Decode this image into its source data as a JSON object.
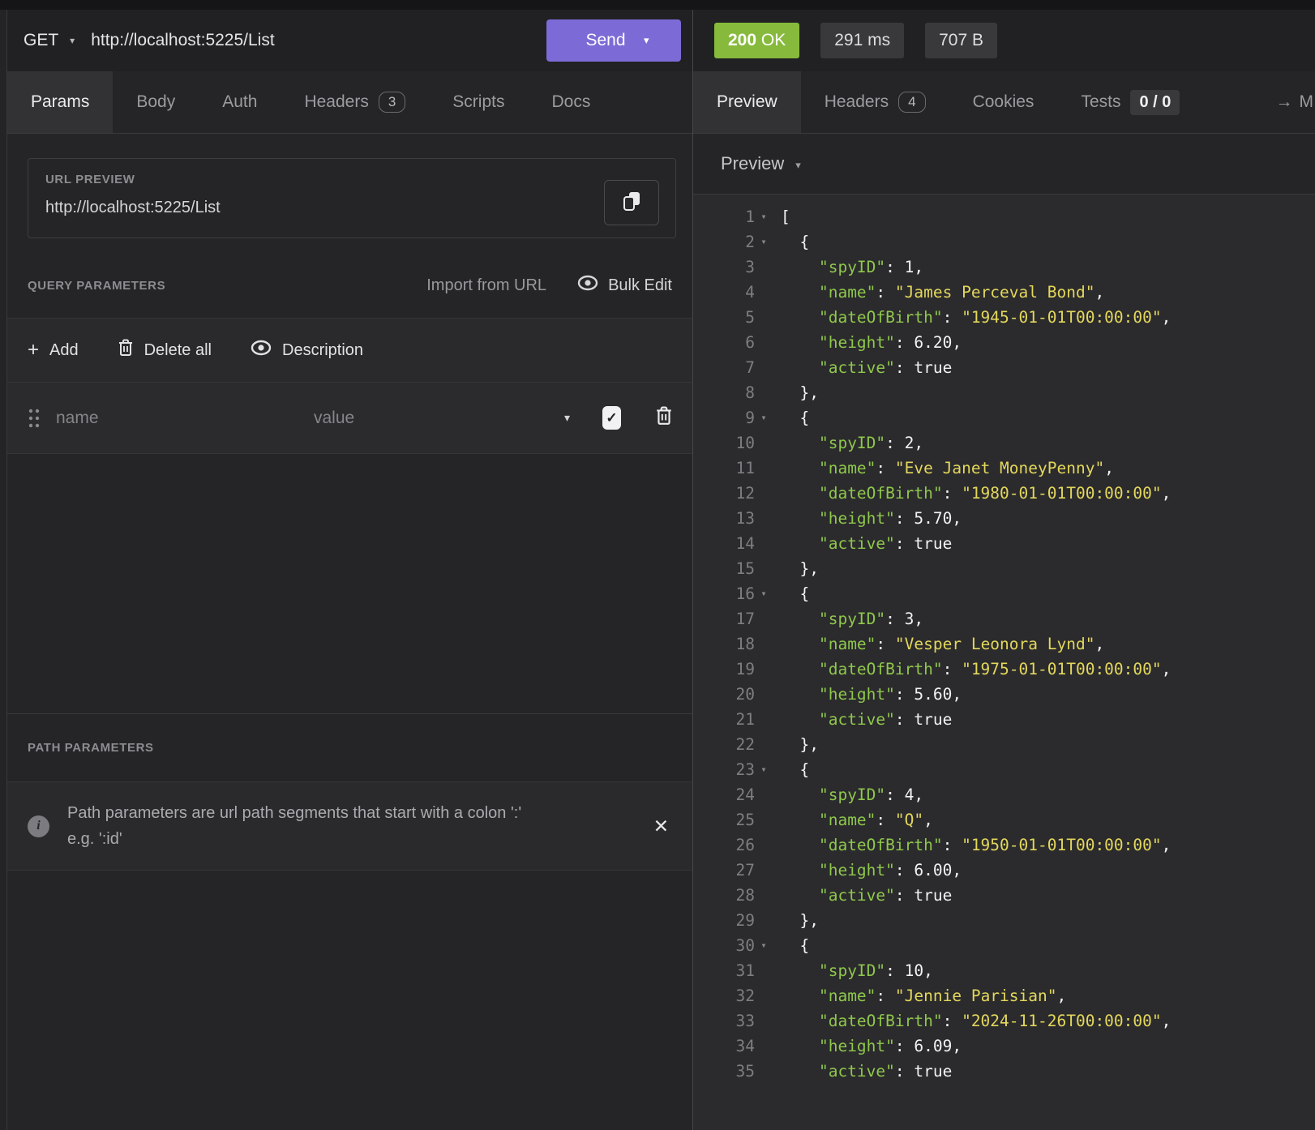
{
  "app": {
    "request": {
      "method": "GET",
      "url": "http://localhost:5225/List",
      "send_label": "Send"
    },
    "request_tabs": [
      {
        "label": "Params",
        "active": true
      },
      {
        "label": "Body"
      },
      {
        "label": "Auth"
      },
      {
        "label": "Headers",
        "badge": "3"
      },
      {
        "label": "Scripts"
      },
      {
        "label": "Docs"
      }
    ],
    "url_preview": {
      "label": "URL PREVIEW",
      "url": "http://localhost:5225/List"
    },
    "query_parameters": {
      "label": "QUERY PARAMETERS",
      "import_from_url": "Import from URL",
      "bulk_edit": "Bulk Edit",
      "add": "Add",
      "delete_all": "Delete all",
      "description": "Description",
      "row": {
        "name_placeholder": "name",
        "value_placeholder": "value",
        "checked": true
      }
    },
    "path_parameters": {
      "label": "PATH PARAMETERS",
      "info_line1": "Path parameters are url path segments that start with a colon ':'",
      "info_line2": "e.g. ':id'"
    },
    "response": {
      "status_code": "200",
      "status_reason": "OK",
      "time": "291 ms",
      "size": "707 B"
    },
    "response_tabs": [
      {
        "label": "Preview",
        "active": true
      },
      {
        "label": "Headers",
        "badge": "4"
      },
      {
        "label": "Cookies"
      },
      {
        "label": "Tests",
        "badge": "0 / 0"
      }
    ],
    "response_overflow_tab": {
      "arrow": "→",
      "label": "M"
    },
    "preview_mode": {
      "label": "Preview"
    }
  },
  "colors": {
    "accent_purple": "#7c6bd6",
    "status_green": "#87ba3c",
    "json_key_green": "#8fc74c",
    "json_string_yellow": "#e3d75c"
  },
  "editor": {
    "lines": [
      {
        "n": 1,
        "fold": true,
        "parts": [
          [
            "p",
            "["
          ]
        ]
      },
      {
        "n": 2,
        "fold": true,
        "parts": [
          [
            "p",
            "  {"
          ]
        ]
      },
      {
        "n": 3,
        "fold": false,
        "parts": [
          [
            "p",
            "    "
          ],
          [
            "k",
            "\"spyID\""
          ],
          [
            "p",
            ": 1,"
          ]
        ]
      },
      {
        "n": 4,
        "fold": false,
        "parts": [
          [
            "p",
            "    "
          ],
          [
            "k",
            "\"name\""
          ],
          [
            "p",
            ": "
          ],
          [
            "s",
            "\"James Perceval Bond\""
          ],
          [
            "p",
            ","
          ]
        ]
      },
      {
        "n": 5,
        "fold": false,
        "parts": [
          [
            "p",
            "    "
          ],
          [
            "k",
            "\"dateOfBirth\""
          ],
          [
            "p",
            ": "
          ],
          [
            "s",
            "\"1945-01-01T00:00:00\""
          ],
          [
            "p",
            ","
          ]
        ]
      },
      {
        "n": 6,
        "fold": false,
        "parts": [
          [
            "p",
            "    "
          ],
          [
            "k",
            "\"height\""
          ],
          [
            "p",
            ": 6.20,"
          ]
        ]
      },
      {
        "n": 7,
        "fold": false,
        "parts": [
          [
            "p",
            "    "
          ],
          [
            "k",
            "\"active\""
          ],
          [
            "p",
            ": true"
          ]
        ]
      },
      {
        "n": 8,
        "fold": false,
        "parts": [
          [
            "p",
            "  },"
          ]
        ]
      },
      {
        "n": 9,
        "fold": true,
        "parts": [
          [
            "p",
            "  {"
          ]
        ]
      },
      {
        "n": 10,
        "fold": false,
        "parts": [
          [
            "p",
            "    "
          ],
          [
            "k",
            "\"spyID\""
          ],
          [
            "p",
            ": 2,"
          ]
        ]
      },
      {
        "n": 11,
        "fold": false,
        "parts": [
          [
            "p",
            "    "
          ],
          [
            "k",
            "\"name\""
          ],
          [
            "p",
            ": "
          ],
          [
            "s",
            "\"Eve Janet MoneyPenny\""
          ],
          [
            "p",
            ","
          ]
        ]
      },
      {
        "n": 12,
        "fold": false,
        "parts": [
          [
            "p",
            "    "
          ],
          [
            "k",
            "\"dateOfBirth\""
          ],
          [
            "p",
            ": "
          ],
          [
            "s",
            "\"1980-01-01T00:00:00\""
          ],
          [
            "p",
            ","
          ]
        ]
      },
      {
        "n": 13,
        "fold": false,
        "parts": [
          [
            "p",
            "    "
          ],
          [
            "k",
            "\"height\""
          ],
          [
            "p",
            ": 5.70,"
          ]
        ]
      },
      {
        "n": 14,
        "fold": false,
        "parts": [
          [
            "p",
            "    "
          ],
          [
            "k",
            "\"active\""
          ],
          [
            "p",
            ": true"
          ]
        ]
      },
      {
        "n": 15,
        "fold": false,
        "parts": [
          [
            "p",
            "  },"
          ]
        ]
      },
      {
        "n": 16,
        "fold": true,
        "parts": [
          [
            "p",
            "  {"
          ]
        ]
      },
      {
        "n": 17,
        "fold": false,
        "parts": [
          [
            "p",
            "    "
          ],
          [
            "k",
            "\"spyID\""
          ],
          [
            "p",
            ": 3,"
          ]
        ]
      },
      {
        "n": 18,
        "fold": false,
        "parts": [
          [
            "p",
            "    "
          ],
          [
            "k",
            "\"name\""
          ],
          [
            "p",
            ": "
          ],
          [
            "s",
            "\"Vesper Leonora Lynd\""
          ],
          [
            "p",
            ","
          ]
        ]
      },
      {
        "n": 19,
        "fold": false,
        "parts": [
          [
            "p",
            "    "
          ],
          [
            "k",
            "\"dateOfBirth\""
          ],
          [
            "p",
            ": "
          ],
          [
            "s",
            "\"1975-01-01T00:00:00\""
          ],
          [
            "p",
            ","
          ]
        ]
      },
      {
        "n": 20,
        "fold": false,
        "parts": [
          [
            "p",
            "    "
          ],
          [
            "k",
            "\"height\""
          ],
          [
            "p",
            ": 5.60,"
          ]
        ]
      },
      {
        "n": 21,
        "fold": false,
        "parts": [
          [
            "p",
            "    "
          ],
          [
            "k",
            "\"active\""
          ],
          [
            "p",
            ": true"
          ]
        ]
      },
      {
        "n": 22,
        "fold": false,
        "parts": [
          [
            "p",
            "  },"
          ]
        ]
      },
      {
        "n": 23,
        "fold": true,
        "parts": [
          [
            "p",
            "  {"
          ]
        ]
      },
      {
        "n": 24,
        "fold": false,
        "parts": [
          [
            "p",
            "    "
          ],
          [
            "k",
            "\"spyID\""
          ],
          [
            "p",
            ": 4,"
          ]
        ]
      },
      {
        "n": 25,
        "fold": false,
        "parts": [
          [
            "p",
            "    "
          ],
          [
            "k",
            "\"name\""
          ],
          [
            "p",
            ": "
          ],
          [
            "s",
            "\"Q\""
          ],
          [
            "p",
            ","
          ]
        ]
      },
      {
        "n": 26,
        "fold": false,
        "parts": [
          [
            "p",
            "    "
          ],
          [
            "k",
            "\"dateOfBirth\""
          ],
          [
            "p",
            ": "
          ],
          [
            "s",
            "\"1950-01-01T00:00:00\""
          ],
          [
            "p",
            ","
          ]
        ]
      },
      {
        "n": 27,
        "fold": false,
        "parts": [
          [
            "p",
            "    "
          ],
          [
            "k",
            "\"height\""
          ],
          [
            "p",
            ": 6.00,"
          ]
        ]
      },
      {
        "n": 28,
        "fold": false,
        "parts": [
          [
            "p",
            "    "
          ],
          [
            "k",
            "\"active\""
          ],
          [
            "p",
            ": true"
          ]
        ]
      },
      {
        "n": 29,
        "fold": false,
        "parts": [
          [
            "p",
            "  },"
          ]
        ]
      },
      {
        "n": 30,
        "fold": true,
        "parts": [
          [
            "p",
            "  {"
          ]
        ]
      },
      {
        "n": 31,
        "fold": false,
        "parts": [
          [
            "p",
            "    "
          ],
          [
            "k",
            "\"spyID\""
          ],
          [
            "p",
            ": 10,"
          ]
        ]
      },
      {
        "n": 32,
        "fold": false,
        "parts": [
          [
            "p",
            "    "
          ],
          [
            "k",
            "\"name\""
          ],
          [
            "p",
            ": "
          ],
          [
            "s",
            "\"Jennie Parisian\""
          ],
          [
            "p",
            ","
          ]
        ]
      },
      {
        "n": 33,
        "fold": false,
        "parts": [
          [
            "p",
            "    "
          ],
          [
            "k",
            "\"dateOfBirth\""
          ],
          [
            "p",
            ": "
          ],
          [
            "s",
            "\"2024-11-26T00:00:00\""
          ],
          [
            "p",
            ","
          ]
        ]
      },
      {
        "n": 34,
        "fold": false,
        "parts": [
          [
            "p",
            "    "
          ],
          [
            "k",
            "\"height\""
          ],
          [
            "p",
            ": 6.09,"
          ]
        ]
      },
      {
        "n": 35,
        "fold": false,
        "parts": [
          [
            "p",
            "    "
          ],
          [
            "k",
            "\"active\""
          ],
          [
            "p",
            ": true"
          ]
        ]
      }
    ]
  }
}
